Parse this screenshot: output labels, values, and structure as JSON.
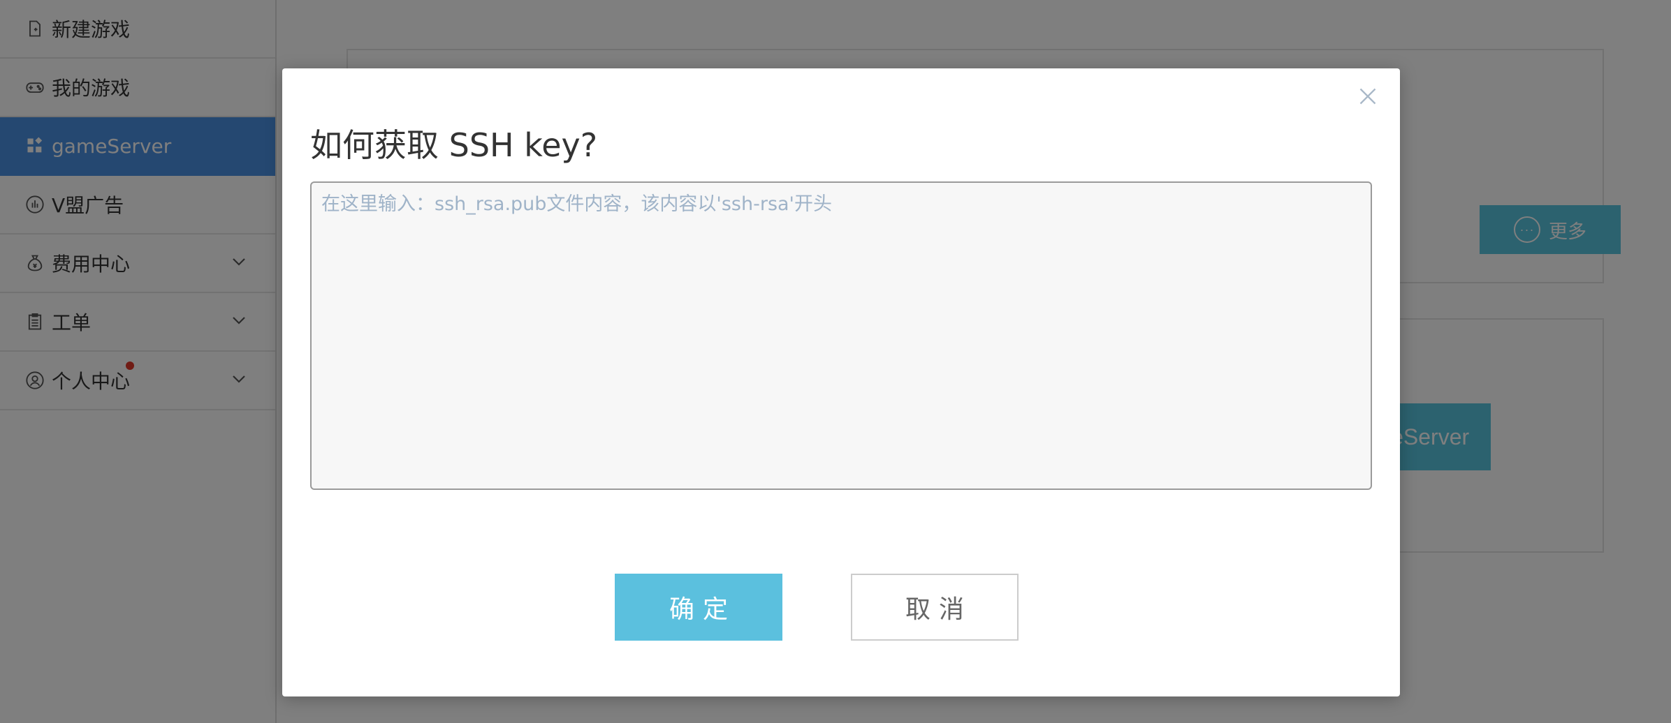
{
  "sidebar": {
    "items": [
      {
        "label": "新建游戏",
        "icon": "new-file-icon",
        "active": false,
        "expandable": false
      },
      {
        "label": "我的游戏",
        "icon": "gamepad-icon",
        "active": false,
        "expandable": false
      },
      {
        "label": "gameServer",
        "icon": "apps-grid-icon",
        "active": true,
        "expandable": false
      },
      {
        "label": "V盟广告",
        "icon": "hand-icon",
        "active": false,
        "expandable": false
      },
      {
        "label": "费用中心",
        "icon": "money-bag-icon",
        "active": false,
        "expandable": true
      },
      {
        "label": "工单",
        "icon": "clipboard-icon",
        "active": false,
        "expandable": true
      },
      {
        "label": "个人中心",
        "icon": "user-circle-icon",
        "active": false,
        "expandable": true,
        "badge": true
      }
    ]
  },
  "main": {
    "more_button_label": "更多",
    "gameserver_button_label": "gameServer"
  },
  "modal": {
    "title": "如何获取 SSH key?",
    "textarea_placeholder": "在这里输入：ssh_rsa.pub文件内容，该内容以'ssh-rsa'开头",
    "textarea_value": "",
    "confirm_label": "确定",
    "cancel_label": "取消"
  },
  "colors": {
    "active_nav": "#4a90e2",
    "primary_button": "#5bc0de",
    "badge": "#e0392b",
    "overlay": "rgba(0,0,0,0.5)"
  }
}
